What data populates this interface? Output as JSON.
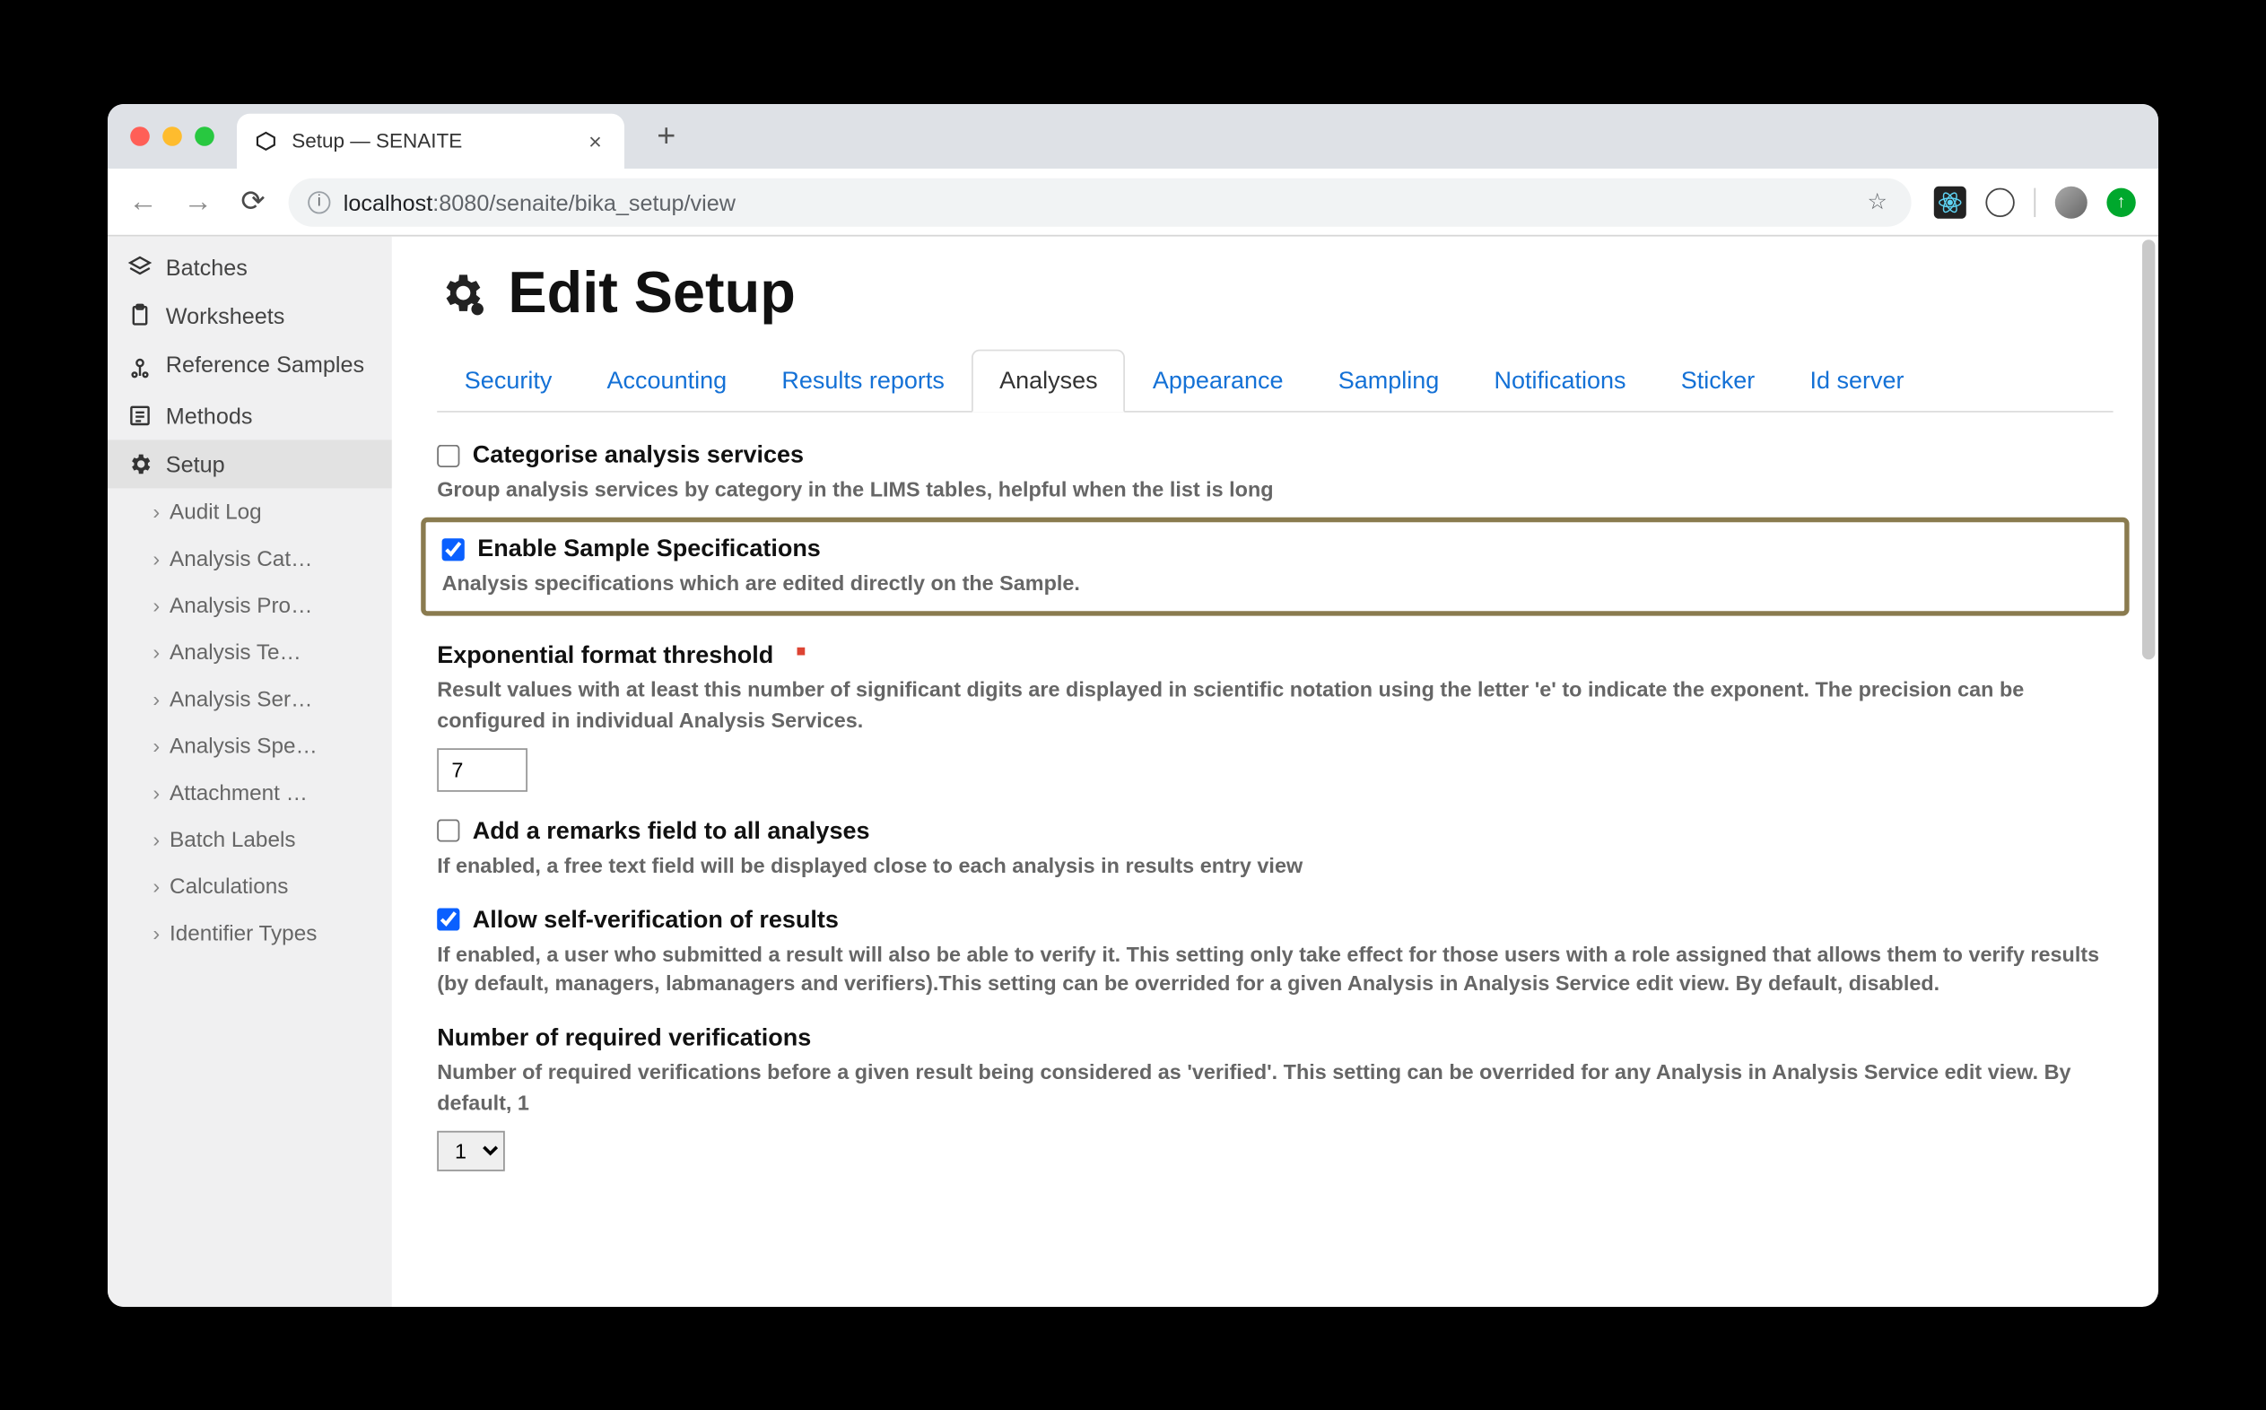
{
  "browser": {
    "tab_title": "Setup — SENAITE",
    "url_host": "localhost",
    "url_port": ":8080",
    "url_path": "/senaite/bika_setup/view"
  },
  "sidebar": {
    "items": [
      {
        "label": "Batches"
      },
      {
        "label": "Worksheets"
      },
      {
        "label": "Reference Samples"
      },
      {
        "label": "Methods"
      },
      {
        "label": "Setup"
      }
    ],
    "sub_items": [
      {
        "label": "Audit Log"
      },
      {
        "label": "Analysis Cat…"
      },
      {
        "label": "Analysis Pro…"
      },
      {
        "label": "Analysis Te…"
      },
      {
        "label": "Analysis Ser…"
      },
      {
        "label": "Analysis Spe…"
      },
      {
        "label": "Attachment …"
      },
      {
        "label": "Batch Labels"
      },
      {
        "label": "Calculations"
      },
      {
        "label": "Identifier Types"
      }
    ]
  },
  "page": {
    "title": "Edit Setup",
    "tabs": [
      {
        "label": "Security"
      },
      {
        "label": "Accounting"
      },
      {
        "label": "Results reports"
      },
      {
        "label": "Analyses",
        "active": true
      },
      {
        "label": "Appearance"
      },
      {
        "label": "Sampling"
      },
      {
        "label": "Notifications"
      },
      {
        "label": "Sticker"
      },
      {
        "label": "Id server"
      }
    ],
    "fields": {
      "categorise": {
        "label": "Categorise analysis services",
        "desc": "Group analysis services by category in the LIMS tables, helpful when the list is long",
        "checked": false
      },
      "enable_specs": {
        "label": "Enable Sample Specifications",
        "desc": "Analysis specifications which are edited directly on the Sample.",
        "checked": true
      },
      "exp_threshold": {
        "label": "Exponential format threshold",
        "required": true,
        "desc": "Result values with at least this number of significant digits are displayed in scientific notation using the letter 'e' to indicate the exponent. The precision can be configured in individual Analysis Services.",
        "value": "7"
      },
      "remarks": {
        "label": "Add a remarks field to all analyses",
        "desc": "If enabled, a free text field will be displayed close to each analysis in results entry view",
        "checked": false
      },
      "self_verify": {
        "label": "Allow self-verification of results",
        "desc": "If enabled, a user who submitted a result will also be able to verify it. This setting only take effect for those users with a role assigned that allows them to verify results (by default, managers, labmanagers and verifiers).This setting can be overrided for a given Analysis in Analysis Service edit view. By default, disabled.",
        "checked": true
      },
      "num_verifications": {
        "label": "Number of required verifications",
        "desc": "Number of required verifications before a given result being considered as 'verified'. This setting can be overrided for any Analysis in Analysis Service edit view. By default, 1",
        "value": "1"
      }
    }
  }
}
